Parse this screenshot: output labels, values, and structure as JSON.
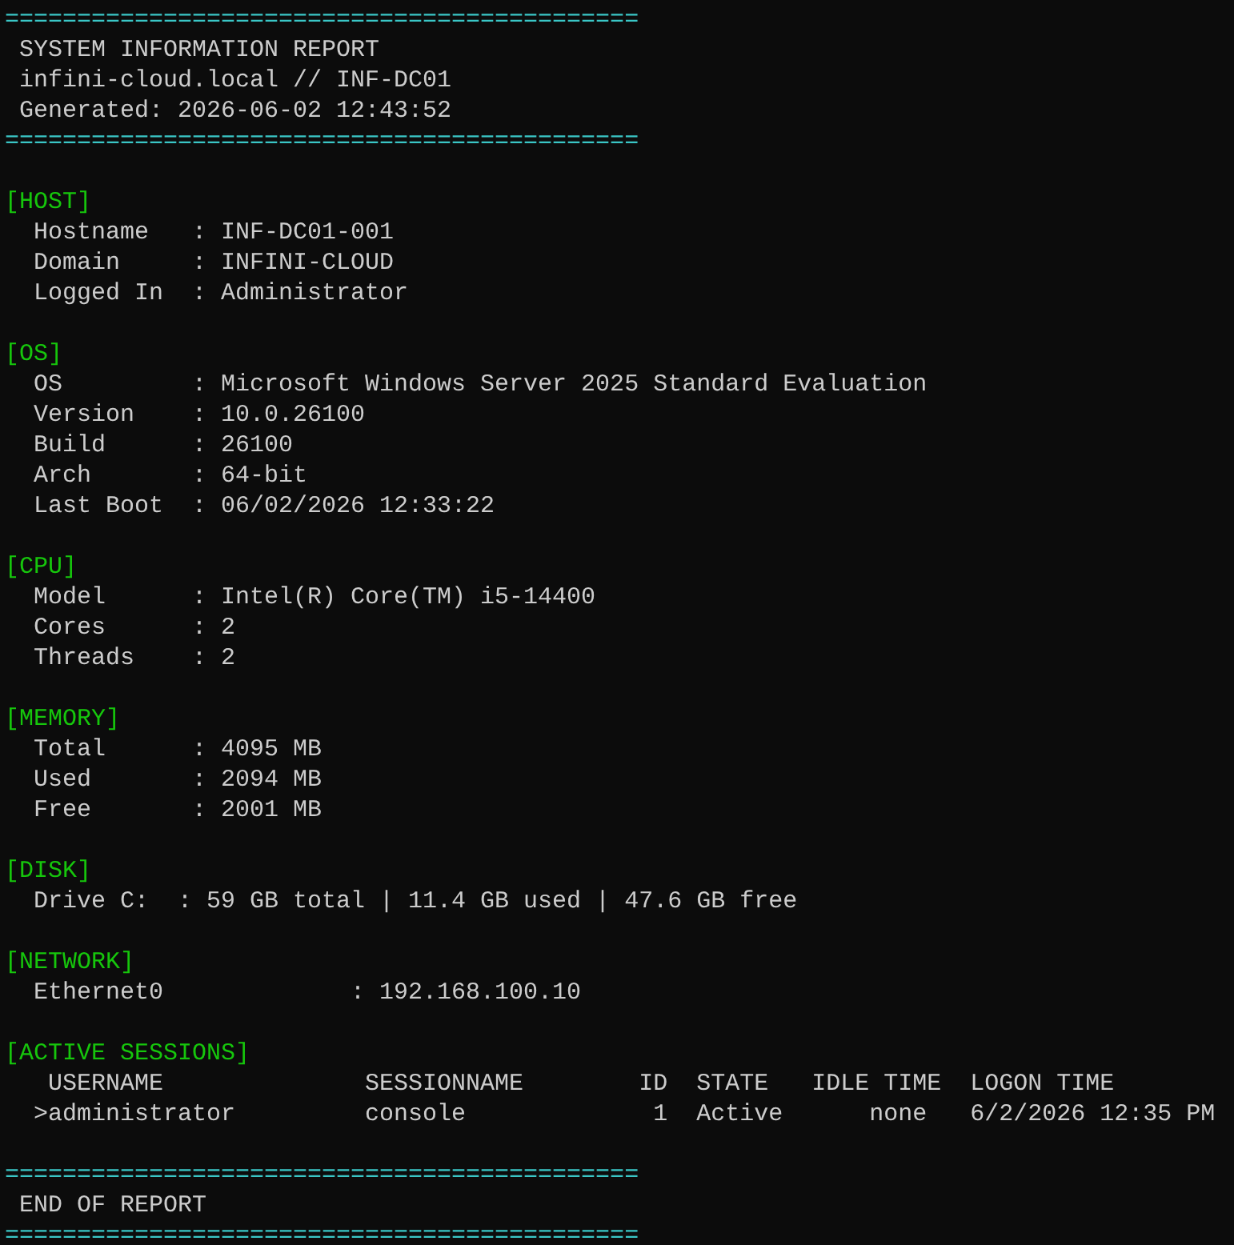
{
  "lines": [
    {
      "kind": "rule",
      "text": "============================================"
    },
    {
      "kind": "text",
      "text": " SYSTEM INFORMATION REPORT"
    },
    {
      "kind": "text",
      "text": " infini-cloud.local // INF-DC01"
    },
    {
      "kind": "text",
      "text": " Generated: 2026-06-02 12:43:52"
    },
    {
      "kind": "rule",
      "text": "============================================"
    },
    {
      "kind": "blank"
    },
    {
      "kind": "heading",
      "text": "[HOST]"
    },
    {
      "kind": "text",
      "text": "  Hostname   : INF-DC01-001"
    },
    {
      "kind": "text",
      "text": "  Domain     : INFINI-CLOUD"
    },
    {
      "kind": "text",
      "text": "  Logged In  : Administrator"
    },
    {
      "kind": "blank"
    },
    {
      "kind": "heading",
      "text": "[OS]"
    },
    {
      "kind": "text",
      "text": "  OS         : Microsoft Windows Server 2025 Standard Evaluation"
    },
    {
      "kind": "text",
      "text": "  Version    : 10.0.26100"
    },
    {
      "kind": "text",
      "text": "  Build      : 26100"
    },
    {
      "kind": "text",
      "text": "  Arch       : 64-bit"
    },
    {
      "kind": "text",
      "text": "  Last Boot  : 06/02/2026 12:33:22"
    },
    {
      "kind": "blank"
    },
    {
      "kind": "heading",
      "text": "[CPU]"
    },
    {
      "kind": "text",
      "text": "  Model      : Intel(R) Core(TM) i5-14400"
    },
    {
      "kind": "text",
      "text": "  Cores      : 2"
    },
    {
      "kind": "text",
      "text": "  Threads    : 2"
    },
    {
      "kind": "blank"
    },
    {
      "kind": "heading",
      "text": "[MEMORY]"
    },
    {
      "kind": "text",
      "text": "  Total      : 4095 MB"
    },
    {
      "kind": "text",
      "text": "  Used       : 2094 MB"
    },
    {
      "kind": "text",
      "text": "  Free       : 2001 MB"
    },
    {
      "kind": "blank"
    },
    {
      "kind": "heading",
      "text": "[DISK]"
    },
    {
      "kind": "text",
      "text": "  Drive C:  : 59 GB total | 11.4 GB used | 47.6 GB free"
    },
    {
      "kind": "blank"
    },
    {
      "kind": "heading",
      "text": "[NETWORK]"
    },
    {
      "kind": "text",
      "text": "  Ethernet0             : 192.168.100.10"
    },
    {
      "kind": "blank"
    },
    {
      "kind": "heading",
      "text": "[ACTIVE SESSIONS]"
    },
    {
      "kind": "text",
      "text": "   USERNAME              SESSIONNAME        ID  STATE   IDLE TIME  LOGON TIME"
    },
    {
      "kind": "text",
      "text": "  >administrator         console             1  Active      none   6/2/2026 12:35 PM"
    },
    {
      "kind": "blank"
    },
    {
      "kind": "rule",
      "text": "============================================"
    },
    {
      "kind": "text",
      "text": " END OF REPORT"
    },
    {
      "kind": "rule",
      "text": "============================================"
    }
  ]
}
